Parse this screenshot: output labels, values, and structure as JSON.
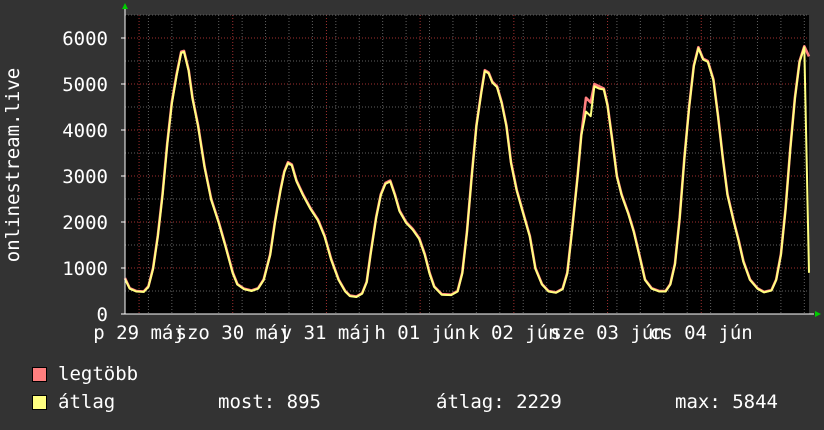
{
  "chart_data": {
    "type": "line",
    "ylabel": "onlinestream.live",
    "ylim": [
      0,
      6500
    ],
    "yticks": [
      0,
      1000,
      2000,
      3000,
      4000,
      5000,
      6000
    ],
    "xlim": [
      0,
      7.3
    ],
    "x_tick_labels": [
      {
        "x": 0.15,
        "label": "p 29 máj"
      },
      {
        "x": 1.15,
        "label": "szo 30 máj"
      },
      {
        "x": 2.15,
        "label": "v 31 máj"
      },
      {
        "x": 3.15,
        "label": "h 01 jún"
      },
      {
        "x": 4.15,
        "label": "k 02 jún"
      },
      {
        "x": 5.15,
        "label": "sze 03 jún"
      },
      {
        "x": 6.15,
        "label": "cs 04 jún"
      }
    ],
    "grid": true,
    "series": [
      {
        "name": "legtöbb",
        "color": "#ff7f7f",
        "points": [
          [
            0,
            780
          ],
          [
            0.05,
            560
          ],
          [
            0.12,
            500
          ],
          [
            0.2,
            490
          ],
          [
            0.25,
            600
          ],
          [
            0.3,
            1000
          ],
          [
            0.35,
            1700
          ],
          [
            0.4,
            2600
          ],
          [
            0.45,
            3700
          ],
          [
            0.5,
            4600
          ],
          [
            0.55,
            5200
          ],
          [
            0.6,
            5700
          ],
          [
            0.63,
            5720
          ],
          [
            0.68,
            5300
          ],
          [
            0.72,
            4700
          ],
          [
            0.78,
            4100
          ],
          [
            0.85,
            3200
          ],
          [
            0.92,
            2500
          ],
          [
            1.0,
            2000
          ],
          [
            1.07,
            1500
          ],
          [
            1.15,
            900
          ],
          [
            1.2,
            650
          ],
          [
            1.27,
            550
          ],
          [
            1.35,
            510
          ],
          [
            1.42,
            560
          ],
          [
            1.48,
            750
          ],
          [
            1.55,
            1300
          ],
          [
            1.6,
            2000
          ],
          [
            1.66,
            2700
          ],
          [
            1.7,
            3100
          ],
          [
            1.74,
            3300
          ],
          [
            1.78,
            3250
          ],
          [
            1.83,
            2900
          ],
          [
            1.9,
            2600
          ],
          [
            1.98,
            2300
          ],
          [
            2.06,
            2050
          ],
          [
            2.13,
            1700
          ],
          [
            2.2,
            1200
          ],
          [
            2.28,
            750
          ],
          [
            2.35,
            500
          ],
          [
            2.4,
            400
          ],
          [
            2.47,
            380
          ],
          [
            2.53,
            450
          ],
          [
            2.58,
            700
          ],
          [
            2.62,
            1300
          ],
          [
            2.68,
            2100
          ],
          [
            2.73,
            2600
          ],
          [
            2.78,
            2850
          ],
          [
            2.83,
            2900
          ],
          [
            2.88,
            2600
          ],
          [
            2.93,
            2250
          ],
          [
            3.0,
            2000
          ],
          [
            3.07,
            1850
          ],
          [
            3.14,
            1650
          ],
          [
            3.2,
            1300
          ],
          [
            3.25,
            900
          ],
          [
            3.3,
            600
          ],
          [
            3.38,
            430
          ],
          [
            3.48,
            420
          ],
          [
            3.55,
            500
          ],
          [
            3.6,
            900
          ],
          [
            3.65,
            1800
          ],
          [
            3.7,
            3000
          ],
          [
            3.75,
            4100
          ],
          [
            3.8,
            4800
          ],
          [
            3.84,
            5300
          ],
          [
            3.88,
            5250
          ],
          [
            3.92,
            5050
          ],
          [
            3.97,
            4950
          ],
          [
            4.02,
            4600
          ],
          [
            4.07,
            4100
          ],
          [
            4.12,
            3300
          ],
          [
            4.18,
            2700
          ],
          [
            4.25,
            2200
          ],
          [
            4.32,
            1700
          ],
          [
            4.38,
            1000
          ],
          [
            4.45,
            650
          ],
          [
            4.52,
            500
          ],
          [
            4.6,
            470
          ],
          [
            4.67,
            550
          ],
          [
            4.72,
            900
          ],
          [
            4.77,
            1800
          ],
          [
            4.83,
            3000
          ],
          [
            4.87,
            3900
          ],
          [
            4.92,
            4700
          ],
          [
            4.97,
            4600
          ],
          [
            5.01,
            5000
          ],
          [
            5.06,
            4950
          ],
          [
            5.11,
            4900
          ],
          [
            5.15,
            4550
          ],
          [
            5.2,
            3800
          ],
          [
            5.25,
            3000
          ],
          [
            5.3,
            2600
          ],
          [
            5.37,
            2200
          ],
          [
            5.43,
            1800
          ],
          [
            5.5,
            1200
          ],
          [
            5.55,
            750
          ],
          [
            5.62,
            560
          ],
          [
            5.7,
            500
          ],
          [
            5.77,
            500
          ],
          [
            5.82,
            650
          ],
          [
            5.87,
            1100
          ],
          [
            5.92,
            2100
          ],
          [
            5.97,
            3400
          ],
          [
            6.02,
            4500
          ],
          [
            6.07,
            5400
          ],
          [
            6.12,
            5800
          ],
          [
            6.17,
            5550
          ],
          [
            6.22,
            5500
          ],
          [
            6.28,
            5100
          ],
          [
            6.33,
            4300
          ],
          [
            6.38,
            3400
          ],
          [
            6.43,
            2600
          ],
          [
            6.5,
            2000
          ],
          [
            6.55,
            1600
          ],
          [
            6.6,
            1150
          ],
          [
            6.67,
            750
          ],
          [
            6.75,
            560
          ],
          [
            6.82,
            480
          ],
          [
            6.9,
            520
          ],
          [
            6.95,
            750
          ],
          [
            7.0,
            1300
          ],
          [
            7.05,
            2300
          ],
          [
            7.1,
            3600
          ],
          [
            7.15,
            4700
          ],
          [
            7.2,
            5500
          ],
          [
            7.25,
            5820
          ],
          [
            7.3,
            5600
          ]
        ]
      },
      {
        "name": "átlag",
        "color": "#ffff80",
        "points": [
          [
            0,
            760
          ],
          [
            0.05,
            550
          ],
          [
            0.12,
            490
          ],
          [
            0.2,
            480
          ],
          [
            0.25,
            590
          ],
          [
            0.3,
            980
          ],
          [
            0.35,
            1680
          ],
          [
            0.4,
            2570
          ],
          [
            0.45,
            3670
          ],
          [
            0.5,
            4570
          ],
          [
            0.55,
            5170
          ],
          [
            0.6,
            5680
          ],
          [
            0.63,
            5700
          ],
          [
            0.68,
            5280
          ],
          [
            0.72,
            4680
          ],
          [
            0.78,
            4080
          ],
          [
            0.85,
            3180
          ],
          [
            0.92,
            2480
          ],
          [
            1.0,
            1980
          ],
          [
            1.07,
            1480
          ],
          [
            1.15,
            880
          ],
          [
            1.2,
            640
          ],
          [
            1.27,
            540
          ],
          [
            1.35,
            500
          ],
          [
            1.42,
            550
          ],
          [
            1.48,
            740
          ],
          [
            1.55,
            1280
          ],
          [
            1.6,
            1980
          ],
          [
            1.66,
            2680
          ],
          [
            1.7,
            3080
          ],
          [
            1.74,
            3280
          ],
          [
            1.78,
            3230
          ],
          [
            1.83,
            2880
          ],
          [
            1.9,
            2580
          ],
          [
            1.98,
            2280
          ],
          [
            2.06,
            2030
          ],
          [
            2.13,
            1680
          ],
          [
            2.2,
            1180
          ],
          [
            2.28,
            740
          ],
          [
            2.35,
            490
          ],
          [
            2.4,
            390
          ],
          [
            2.47,
            370
          ],
          [
            2.53,
            440
          ],
          [
            2.58,
            690
          ],
          [
            2.62,
            1280
          ],
          [
            2.68,
            2080
          ],
          [
            2.73,
            2580
          ],
          [
            2.78,
            2830
          ],
          [
            2.83,
            2880
          ],
          [
            2.88,
            2580
          ],
          [
            2.93,
            2230
          ],
          [
            3.0,
            1980
          ],
          [
            3.07,
            1830
          ],
          [
            3.14,
            1630
          ],
          [
            3.2,
            1280
          ],
          [
            3.25,
            880
          ],
          [
            3.3,
            590
          ],
          [
            3.38,
            420
          ],
          [
            3.48,
            410
          ],
          [
            3.55,
            490
          ],
          [
            3.6,
            880
          ],
          [
            3.65,
            1780
          ],
          [
            3.7,
            2980
          ],
          [
            3.75,
            4080
          ],
          [
            3.8,
            4780
          ],
          [
            3.84,
            5280
          ],
          [
            3.88,
            5230
          ],
          [
            3.92,
            5030
          ],
          [
            3.97,
            4930
          ],
          [
            4.02,
            4580
          ],
          [
            4.07,
            4080
          ],
          [
            4.12,
            3280
          ],
          [
            4.18,
            2680
          ],
          [
            4.25,
            2180
          ],
          [
            4.32,
            1680
          ],
          [
            4.38,
            980
          ],
          [
            4.45,
            640
          ],
          [
            4.52,
            490
          ],
          [
            4.6,
            460
          ],
          [
            4.67,
            540
          ],
          [
            4.72,
            880
          ],
          [
            4.77,
            1780
          ],
          [
            4.83,
            2980
          ],
          [
            4.87,
            3880
          ],
          [
            4.92,
            4400
          ],
          [
            4.97,
            4300
          ],
          [
            5.01,
            4950
          ],
          [
            5.06,
            4900
          ],
          [
            5.11,
            4880
          ],
          [
            5.15,
            4530
          ],
          [
            5.2,
            3780
          ],
          [
            5.25,
            2980
          ],
          [
            5.3,
            2580
          ],
          [
            5.37,
            2180
          ],
          [
            5.43,
            1780
          ],
          [
            5.5,
            1180
          ],
          [
            5.55,
            740
          ],
          [
            5.62,
            550
          ],
          [
            5.7,
            490
          ],
          [
            5.77,
            490
          ],
          [
            5.82,
            640
          ],
          [
            5.87,
            1080
          ],
          [
            5.92,
            2080
          ],
          [
            5.97,
            3380
          ],
          [
            6.02,
            4480
          ],
          [
            6.07,
            5380
          ],
          [
            6.12,
            5780
          ],
          [
            6.17,
            5530
          ],
          [
            6.22,
            5480
          ],
          [
            6.28,
            5080
          ],
          [
            6.33,
            4280
          ],
          [
            6.38,
            3380
          ],
          [
            6.43,
            2580
          ],
          [
            6.5,
            1980
          ],
          [
            6.55,
            1580
          ],
          [
            6.6,
            1130
          ],
          [
            6.67,
            740
          ],
          [
            6.75,
            550
          ],
          [
            6.82,
            470
          ],
          [
            6.9,
            510
          ],
          [
            6.95,
            740
          ],
          [
            7.0,
            1280
          ],
          [
            7.05,
            2280
          ],
          [
            7.1,
            3580
          ],
          [
            7.15,
            4680
          ],
          [
            7.2,
            5480
          ],
          [
            7.25,
            5800
          ],
          [
            7.3,
            895
          ]
        ]
      }
    ]
  },
  "legend": {
    "items": [
      {
        "label": "legtöbb",
        "color": "#ff7f7f"
      },
      {
        "label": "átlag",
        "color": "#ffff80"
      }
    ]
  },
  "stats": {
    "now": "most: 895",
    "avg": "átlag: 2229",
    "max": "max: 5844"
  }
}
